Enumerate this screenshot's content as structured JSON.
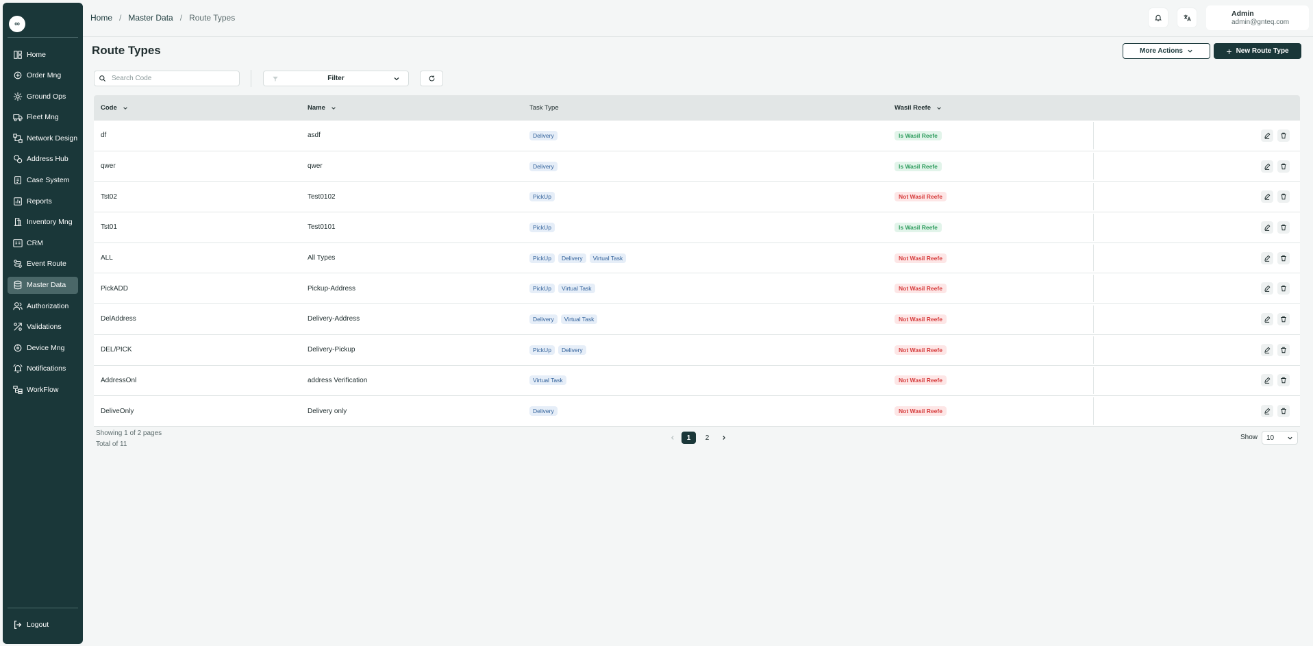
{
  "sidebar": {
    "logo_glyph": "∞",
    "items": [
      {
        "label": "Home",
        "icon": "home-icon",
        "active": false
      },
      {
        "label": "Order Mng",
        "icon": "order-icon",
        "active": false
      },
      {
        "label": "Ground Ops",
        "icon": "ground-ops-icon",
        "active": false
      },
      {
        "label": "Fleet Mng",
        "icon": "truck-icon",
        "active": false
      },
      {
        "label": "Network Design",
        "icon": "network-icon",
        "active": false
      },
      {
        "label": "Address Hub",
        "icon": "address-icon",
        "active": false
      },
      {
        "label": "Case System",
        "icon": "case-icon",
        "active": false
      },
      {
        "label": "Reports",
        "icon": "report-icon",
        "active": false
      },
      {
        "label": "Inventory Mng",
        "icon": "inventory-icon",
        "active": false
      },
      {
        "label": "CRM",
        "icon": "crm-icon",
        "active": false
      },
      {
        "label": "Event Route",
        "icon": "route-icon",
        "active": false
      },
      {
        "label": "Master Data",
        "icon": "database-icon",
        "active": true
      },
      {
        "label": "Authorization",
        "icon": "users-icon",
        "active": false
      },
      {
        "label": "Validations",
        "icon": "validation-icon",
        "active": false
      },
      {
        "label": "Device Mng",
        "icon": "device-icon",
        "active": false
      },
      {
        "label": "Notifications",
        "icon": "bell-icon",
        "active": false
      },
      {
        "label": "WorkFlow",
        "icon": "workflow-icon",
        "active": false
      }
    ],
    "logout_label": "Logout"
  },
  "header": {
    "breadcrumb": {
      "home": "Home",
      "sep1": "/",
      "section": "Master Data",
      "sep2": "/",
      "current": "Route Types"
    },
    "user": {
      "name": "Admin",
      "email": "admin@gnteq.com"
    }
  },
  "page": {
    "title": "Route Types",
    "more_actions_label": "More Actions",
    "new_button_label": "New Route Type",
    "search_placeholder": "Search Code",
    "filter_label": "Filter"
  },
  "table": {
    "columns": {
      "code": "Code",
      "name": "Name",
      "task_type": "Task Type",
      "wasil_reefe": "Wasil Reefe"
    },
    "rows": [
      {
        "code": "df",
        "name": "asdf",
        "tasks": [
          "Delivery"
        ],
        "status": "Is Wasil Reefe"
      },
      {
        "code": "qwer",
        "name": "qwer",
        "tasks": [
          "Delivery"
        ],
        "status": "Is Wasil Reefe"
      },
      {
        "code": "Tst02",
        "name": "Test0102",
        "tasks": [
          "PickUp"
        ],
        "status": "Not Wasil Reefe"
      },
      {
        "code": "Tst01",
        "name": "Test0101",
        "tasks": [
          "PickUp"
        ],
        "status": "Is Wasil Reefe"
      },
      {
        "code": "ALL",
        "name": "All Types",
        "tasks": [
          "PickUp",
          "Delivery",
          "Virtual Task"
        ],
        "status": "Not Wasil Reefe"
      },
      {
        "code": "PickADD",
        "name": "Pickup-Address",
        "tasks": [
          "PickUp",
          "Virtual Task"
        ],
        "status": "Not Wasil Reefe"
      },
      {
        "code": "DelAddress",
        "name": "Delivery-Address",
        "tasks": [
          "Delivery",
          "Virtual Task"
        ],
        "status": "Not Wasil Reefe"
      },
      {
        "code": "DEL/PICK",
        "name": "Delivery-Pickup",
        "tasks": [
          "PickUp",
          "Delivery"
        ],
        "status": "Not Wasil Reefe"
      },
      {
        "code": "AddressOnl",
        "name": "address Verification",
        "tasks": [
          "Virtual Task"
        ],
        "status": "Not Wasil Reefe"
      },
      {
        "code": "DeliveOnly",
        "name": "Delivery only",
        "tasks": [
          "Delivery"
        ],
        "status": "Not Wasil Reefe"
      }
    ]
  },
  "footer": {
    "showing": "Showing 1 of 2 pages",
    "total": "Total of 11",
    "pages": [
      "1",
      "2"
    ],
    "current_page": "1",
    "show_label": "Show",
    "page_size": "10"
  },
  "colors": {
    "sidebar_bg": "#1a3739",
    "primary": "#1a3739",
    "status_ok": "#2e9c5d",
    "status_no": "#d63c3c",
    "chip_text": "#2f5f99"
  }
}
